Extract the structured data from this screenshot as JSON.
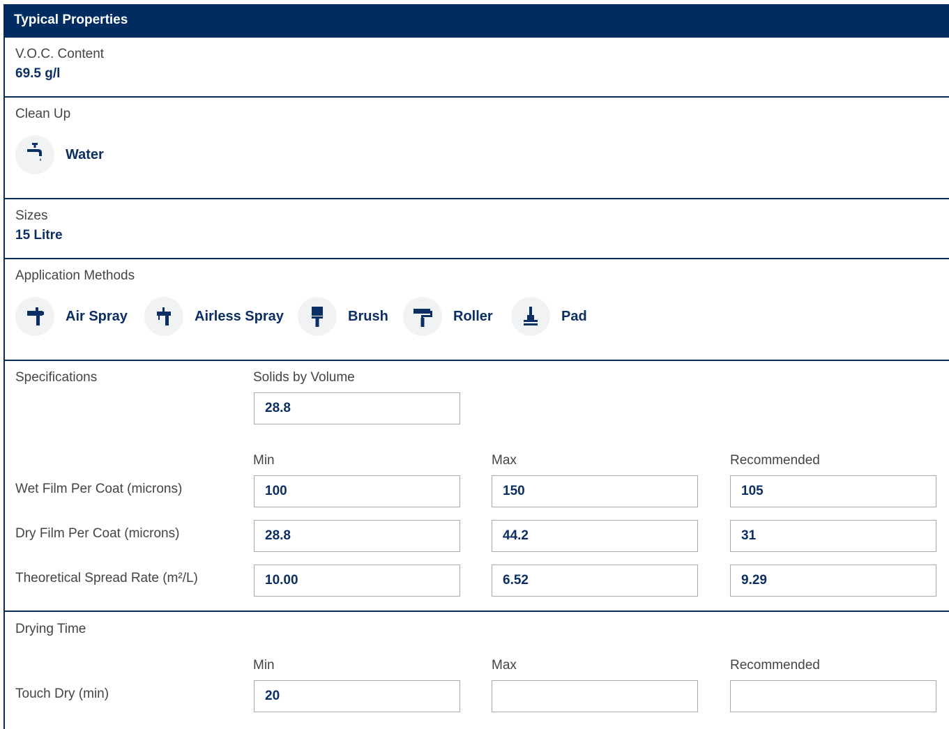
{
  "header": {
    "title": "Typical Properties"
  },
  "voc": {
    "label": "V.O.C. Content",
    "value": "69.5 g/l"
  },
  "cleanup": {
    "label": "Clean Up",
    "item": {
      "label": "Water",
      "icon": "water-tap-icon"
    }
  },
  "sizes": {
    "label": "Sizes",
    "value": "15 Litre"
  },
  "application": {
    "label": "Application Methods",
    "methods": [
      {
        "label": "Air Spray",
        "icon": "air-spray-gun-icon"
      },
      {
        "label": "Airless Spray",
        "icon": "airless-spray-gun-icon"
      },
      {
        "label": "Brush",
        "icon": "brush-icon"
      },
      {
        "label": "Roller",
        "icon": "roller-icon"
      },
      {
        "label": "Pad",
        "icon": "pad-icon"
      }
    ]
  },
  "specifications": {
    "label": "Specifications",
    "solids_label": "Solids by Volume",
    "solids_value": "28.8",
    "col_min": "Min",
    "col_max": "Max",
    "col_rec": "Recommended",
    "rows": [
      {
        "label": "Wet Film Per Coat (microns)",
        "min": "100",
        "max": "150",
        "rec": "105"
      },
      {
        "label": "Dry Film Per Coat (microns)",
        "min": "28.8",
        "max": "44.2",
        "rec": "31"
      },
      {
        "label": "Theoretical Spread Rate (m²/L)",
        "min": "10.00",
        "max": "6.52",
        "rec": "9.29"
      }
    ]
  },
  "drying": {
    "label": "Drying Time",
    "col_min": "Min",
    "col_max": "Max",
    "col_rec": "Recommended",
    "rows": [
      {
        "label": "Touch Dry (min)",
        "min": "20",
        "max": "",
        "rec": ""
      }
    ]
  },
  "colors": {
    "navy": "#002c62",
    "text_value": "#0b2f64",
    "icon_bg": "#f1f2f4",
    "input_border": "#a9a9a9"
  }
}
